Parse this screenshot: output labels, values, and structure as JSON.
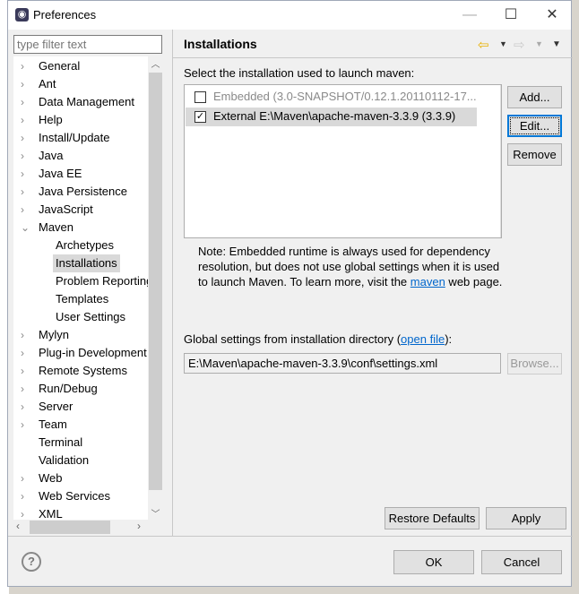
{
  "window": {
    "title": "Preferences",
    "minimize": "—",
    "maximize": "☐",
    "close": "✕"
  },
  "filter": {
    "placeholder": "type filter text"
  },
  "tree": [
    {
      "label": "General",
      "expanded": false,
      "level": 0
    },
    {
      "label": "Ant",
      "expanded": false,
      "level": 0
    },
    {
      "label": "Data Management",
      "expanded": false,
      "level": 0
    },
    {
      "label": "Help",
      "expanded": false,
      "level": 0
    },
    {
      "label": "Install/Update",
      "expanded": false,
      "level": 0
    },
    {
      "label": "Java",
      "expanded": false,
      "level": 0
    },
    {
      "label": "Java EE",
      "expanded": false,
      "level": 0
    },
    {
      "label": "Java Persistence",
      "expanded": false,
      "level": 0
    },
    {
      "label": "JavaScript",
      "expanded": false,
      "level": 0
    },
    {
      "label": "Maven",
      "expanded": true,
      "level": 0
    },
    {
      "label": "Archetypes",
      "level": 1
    },
    {
      "label": "Installations",
      "level": 1,
      "selected": true
    },
    {
      "label": "Problem Reporting",
      "level": 1
    },
    {
      "label": "Templates",
      "level": 1
    },
    {
      "label": "User Settings",
      "level": 1
    },
    {
      "label": "Mylyn",
      "expanded": false,
      "level": 0
    },
    {
      "label": "Plug-in Development",
      "expanded": false,
      "level": 0
    },
    {
      "label": "Remote Systems",
      "expanded": false,
      "level": 0
    },
    {
      "label": "Run/Debug",
      "expanded": false,
      "level": 0
    },
    {
      "label": "Server",
      "expanded": false,
      "level": 0
    },
    {
      "label": "Team",
      "expanded": false,
      "level": 0
    },
    {
      "label": "Terminal",
      "level": 0
    },
    {
      "label": "Validation",
      "level": 0
    },
    {
      "label": "Web",
      "expanded": false,
      "level": 0
    },
    {
      "label": "Web Services",
      "expanded": false,
      "level": 0
    },
    {
      "label": "XML",
      "expanded": false,
      "level": 0
    }
  ],
  "page": {
    "title": "Installations",
    "select_label": "Select the installation used to launch maven:",
    "installations": [
      {
        "label": "Embedded (3.0-SNAPSHOT/0.12.1.20110112-17...",
        "checked": false,
        "disabled": true
      },
      {
        "label": "External E:\\Maven\\apache-maven-3.3.9 (3.3.9)",
        "checked": true,
        "selected": true
      }
    ],
    "buttons": {
      "add": "Add...",
      "edit": "Edit...",
      "remove": "Remove"
    },
    "note_before": "Note: Embedded runtime is always used for dependency resolution, but does not use global settings when it is used to launch Maven. To learn more, visit the ",
    "note_link": "maven",
    "note_after": " web page.",
    "global_label_before": "Global settings from installation directory (",
    "global_link": "open file",
    "global_label_after": "):",
    "global_value": "E:\\Maven\\apache-maven-3.3.9\\conf\\settings.xml",
    "browse": "Browse...",
    "restore": "Restore Defaults",
    "apply": "Apply"
  },
  "footer": {
    "ok": "OK",
    "cancel": "Cancel"
  }
}
